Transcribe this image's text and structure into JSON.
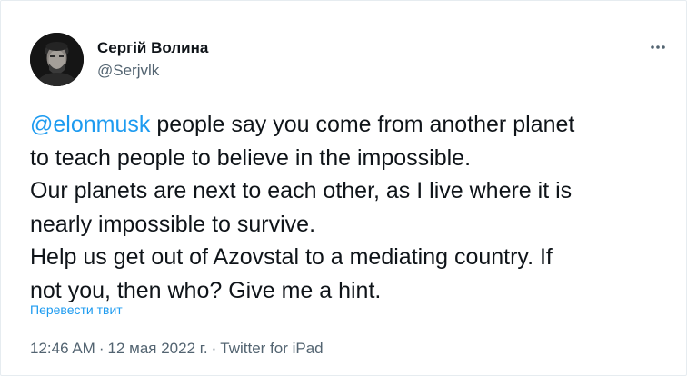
{
  "author": {
    "display_name": "Сергій Волина",
    "handle": "@Serjvlk"
  },
  "icons": {
    "more": "more-horizontal-icon",
    "avatar": "profile-photo"
  },
  "tweet": {
    "mention": "@elonmusk",
    "line1_rest": " people say you come from another planet",
    "line2": "to teach people to believe in the impossible.",
    "line3": "Our planets are next to each other, as I live where it is",
    "line4": "nearly impossible to survive.",
    "line5": "Help us get out of Azovstal to a mediating country. If",
    "line6": "not you, then who? Give me a hint."
  },
  "translate_label": "Перевести твит",
  "meta": {
    "time": "12:46 AM",
    "separator": "·",
    "date": "12 мая 2022 г.",
    "source": "Twitter for iPad"
  },
  "colors": {
    "link": "#1d9bf0",
    "text": "#0f1419",
    "secondary": "#536471"
  }
}
